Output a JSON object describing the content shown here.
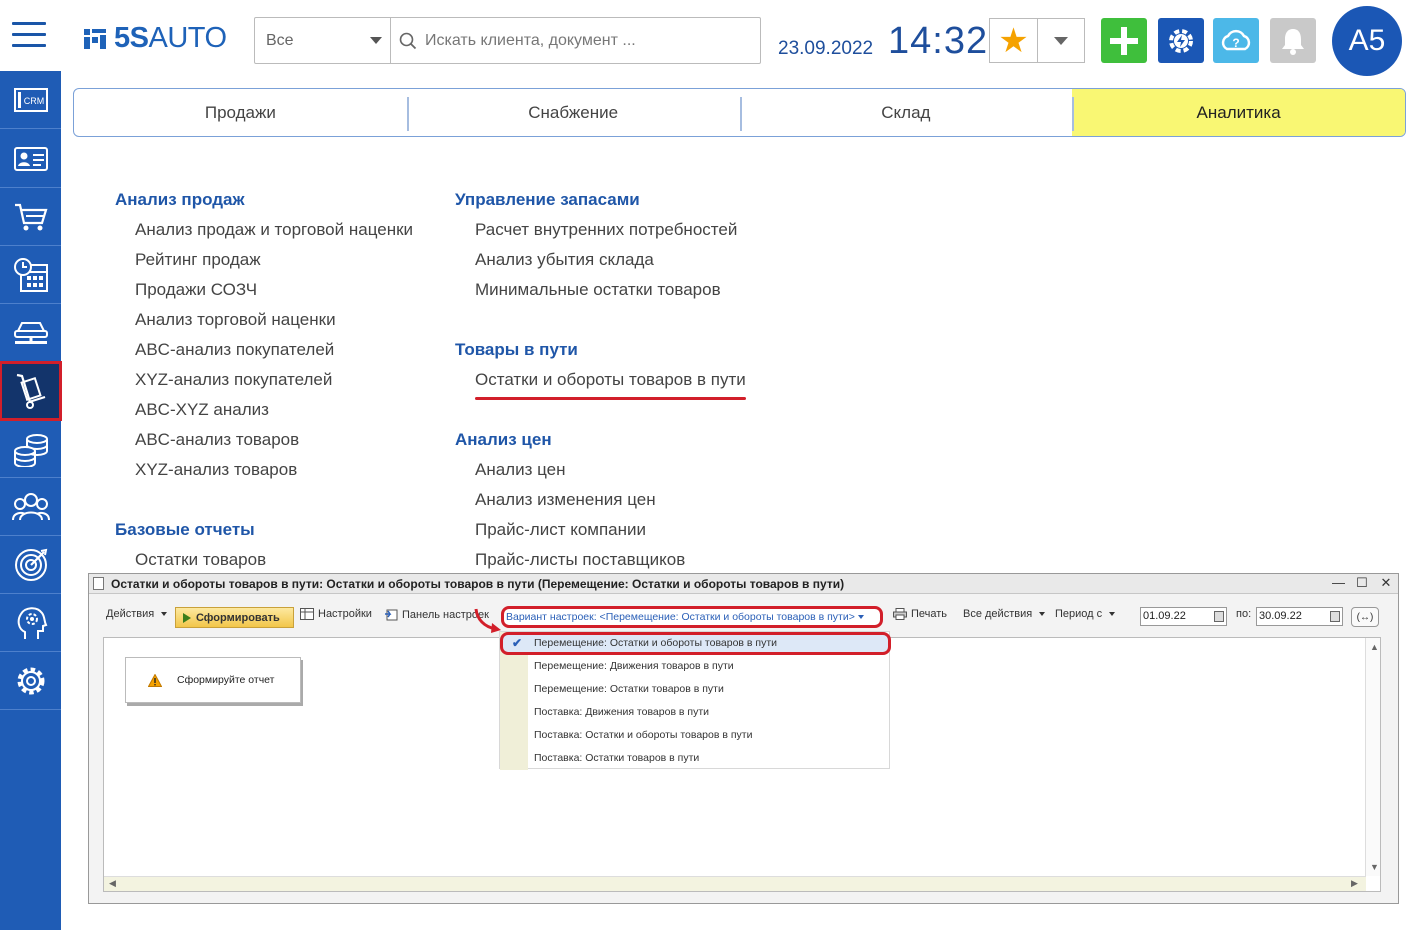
{
  "header": {
    "logo_prefix": "5S",
    "logo_suffix": "AUTO",
    "scope": "Все",
    "search_placeholder": "Искать клиента, документ ...",
    "date": "23.09.2022",
    "time": "14:32",
    "avatar": "А5",
    "colors": {
      "brand": "#1e62b8",
      "add": "#3fbf3c",
      "accent": "#1b57b5",
      "help": "#4cb8e8",
      "star": "#f5a200"
    }
  },
  "sidebar": {
    "items": [
      {
        "name": "crm-icon",
        "label": "CRM"
      },
      {
        "name": "contacts-card-icon"
      },
      {
        "name": "shopping-cart-icon"
      },
      {
        "name": "schedule-calendar-icon"
      },
      {
        "name": "car-lift-icon"
      },
      {
        "name": "warehouse-trolley-icon",
        "active": true
      },
      {
        "name": "coins-stack-icon"
      },
      {
        "name": "people-group-icon"
      },
      {
        "name": "target-icon"
      },
      {
        "name": "head-gear-icon"
      },
      {
        "name": "settings-gear-icon"
      }
    ]
  },
  "tabs": [
    {
      "label": "Продажи"
    },
    {
      "label": "Снабжение"
    },
    {
      "label": "Склад"
    },
    {
      "label": "Аналитика",
      "active": true
    }
  ],
  "menu": {
    "left": {
      "sales_title": "Анализ продаж",
      "sales_items": [
        "Анализ продаж и торговой наценки",
        "Рейтинг продаж",
        "Продажи СОЗЧ",
        "Анализ торговой наценки",
        "ABC-анализ покупателей",
        "XYZ-анализ покупателей",
        "ABC-XYZ анализ",
        "ABC-анализ товаров",
        "XYZ-анализ товаров"
      ],
      "base_title": "Базовые отчеты",
      "base_items": [
        "Остатки товаров"
      ]
    },
    "right": {
      "stock_title": "Управление запасами",
      "stock_items": [
        "Расчет внутренних потребностей",
        "Анализ убытия склада",
        "Минимальные остатки товаров"
      ],
      "transit_title": "Товары в пути",
      "transit_items": [
        "Остатки и обороты товаров в пути"
      ],
      "price_title": "Анализ цен",
      "price_items": [
        "Анализ цен",
        "Анализ изменения цен",
        "Прайс-лист компании",
        "Прайс-листы поставщиков"
      ]
    }
  },
  "report": {
    "title": "Остатки и обороты товаров в пути: Остатки и обороты товаров в пути (Перемещение:  Остатки и обороты товаров в пути)",
    "controls": {
      "minimize": "—",
      "maximize": "☐",
      "close": "✕"
    },
    "toolbar": {
      "actions": "Действия",
      "generate": "Сформировать",
      "settings": "Настройки",
      "settings_panel": "Панель настроек",
      "variant": "Вариант настроек: <Перемещение:  Остатки и обороты товаров в пути>",
      "print": "Печать",
      "all_actions": "Все действия",
      "period_from_label": "Период с",
      "period_from": "01.09.22",
      "period_to_label": "по:",
      "period_to": "30.09.22",
      "period_button": "(↔)"
    },
    "hint": "Сформируйте отчет",
    "variants": [
      {
        "label": "Перемещение:  Остатки и обороты товаров в пути",
        "selected": true
      },
      {
        "label": "Перемещение: Движения товаров в пути"
      },
      {
        "label": "Перемещение: Остатки товаров в пути"
      },
      {
        "label": "Поставка: Движения товаров в пути"
      },
      {
        "label": "Поставка: Остатки и обороты товаров в пути"
      },
      {
        "label": "Поставка: Остатки товаров в пути"
      }
    ]
  }
}
